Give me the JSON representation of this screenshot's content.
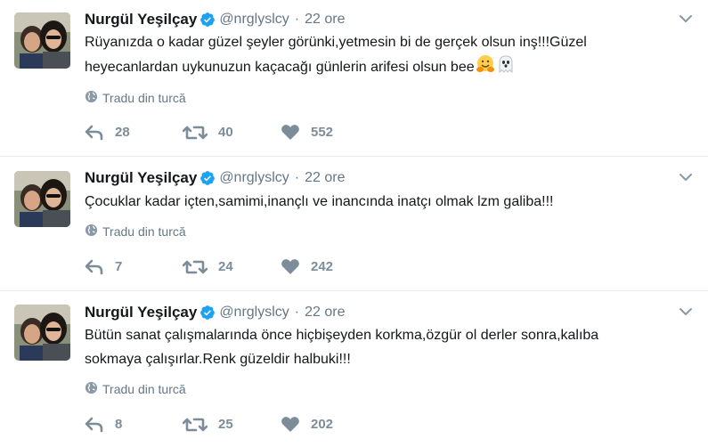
{
  "tweets": [
    {
      "fullname": "Nurgül Yeşilçay",
      "username": "@nrglyslcy",
      "time": "22 ore",
      "text_lines": [
        "Rüyanızda o kadar güzel şeyler görünki,yetmesin bi de gerçek olsun inş!!!Güzel",
        "heyecanlardan uykunuzun kaçacağı günlerin arifesi olsun bee"
      ],
      "emojis": [
        "hugging-face-emoji",
        "ghost-emoji"
      ],
      "translate_label": "Tradu din turcă",
      "reply_count": "28",
      "retweet_count": "40",
      "like_count": "552"
    },
    {
      "fullname": "Nurgül Yeşilçay",
      "username": "@nrglyslcy",
      "time": "22 ore",
      "text_lines": [
        "Çocuklar kadar içten,samimi,inançlı ve inancında inatçı olmak lzm galiba!!!"
      ],
      "emojis": [],
      "translate_label": "Tradu din turcă",
      "reply_count": "7",
      "retweet_count": "24",
      "like_count": "242"
    },
    {
      "fullname": "Nurgül Yeşilçay",
      "username": "@nrglyslcy",
      "time": "22 ore",
      "text_lines": [
        "Bütün sanat çalışmalarında önce hiçbişeyden korkma,özgür ol derler sonra,kalıba",
        "sokmaya çalışırlar.Renk güzeldir halbuki!!!"
      ],
      "emojis": [],
      "translate_label": "Tradu din turcă",
      "reply_count": "8",
      "retweet_count": "25",
      "like_count": "202"
    }
  ],
  "colors": {
    "secondary_text": "#657786",
    "action_gray": "#7d8c99",
    "verified_blue": "#1da1f2",
    "divider": "#e6ecf0"
  },
  "icons": {
    "verified": "verified-badge-icon",
    "caret": "chevron-down-icon",
    "globe": "globe-icon",
    "reply": "reply-icon",
    "retweet": "retweet-icon",
    "like": "heart-icon"
  }
}
